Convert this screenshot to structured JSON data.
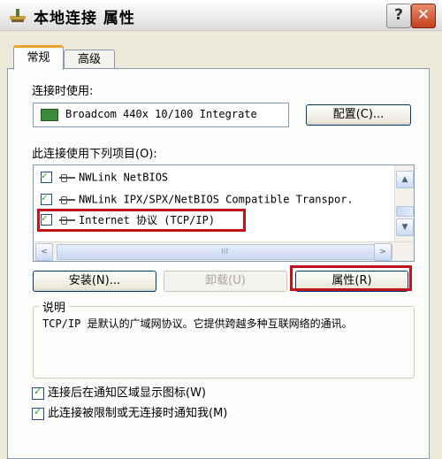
{
  "window": {
    "title": "本地连接 属性",
    "help_glyph": "?",
    "close_glyph": "✕"
  },
  "tabs": [
    {
      "label": "常规",
      "selected": true
    },
    {
      "label": "高级",
      "selected": false
    }
  ],
  "connect_using": {
    "label": "连接时使用:",
    "adapter": "Broadcom 440x 10/100 Integrate",
    "config_button": "配置(C)..."
  },
  "items": {
    "label": "此连接使用下列项目(O):",
    "rows": [
      {
        "text": "NWLink NetBIOS",
        "checked": true
      },
      {
        "text": "NWLink IPX/SPX/NetBIOS Compatible Transpor.",
        "checked": true
      },
      {
        "text": "Internet 协议 (TCP/IP)",
        "checked": true,
        "highlighted": true
      }
    ],
    "scroll_up": "▲",
    "scroll_down": "▼",
    "scroll_left": "<",
    "scroll_right": ">",
    "hscroll_grip": "III"
  },
  "buttons": {
    "install": "安装(N)...",
    "uninstall": "卸载(U)",
    "properties": "属性(R)"
  },
  "description": {
    "title": "说明",
    "text": "TCP/IP 是默认的广域网协议。它提供跨越多种互联网络的通讯。"
  },
  "options": [
    {
      "label": "连接后在通知区域显示图标(W)",
      "checked": true
    },
    {
      "label": "此连接被限制或无连接时通知我(M)",
      "checked": true
    }
  ],
  "colors": {
    "highlight_border": "#c0141c",
    "xp_face": "#ece9d8",
    "tab_accent": "#f0a030"
  }
}
